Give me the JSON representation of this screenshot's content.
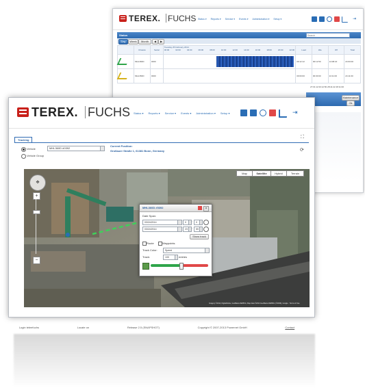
{
  "brand": {
    "name_bold": "TEREX.",
    "name_light": "FUCHS"
  },
  "colors": {
    "brand_red": "#c8201a",
    "link_blue": "#2a6db5",
    "panel_blue": "#2d6ab0",
    "track_green": "#2fa54a",
    "track_red": "#e04848"
  },
  "nav": {
    "items": [
      "Status ▾",
      "Reports ▾",
      "Service ▾",
      "Events ▾",
      "Administration ▾",
      "Setup ▾"
    ],
    "toolbar_icons": [
      "machine-icon",
      "document-icon",
      "globe-icon",
      "wrench-icon",
      "chart-icon",
      "logout-icon"
    ]
  },
  "back_window": {
    "panel_title": "Status",
    "search_placeholder": "Search",
    "view_buttons": [
      "Day",
      "Week",
      "Month"
    ],
    "timeline_label": "Tuesday 25 February 2014",
    "columns": [
      "Chassis",
      "Serial"
    ],
    "time_labels": [
      "00:00",
      "02:00",
      "04:00",
      "06:00",
      "08:00",
      "10:00",
      "12:00",
      "14:00",
      "16:00",
      "18:00",
      "20:00",
      "22:00"
    ],
    "right_columns": [
      "Load",
      "Idle",
      "Off",
      "Total"
    ],
    "rows": [
      {
        "chassis": "MHL360D",
        "serial": "0000",
        "values": [
          "09:12:12",
          "00:12:50",
          "14:08:22",
          "24:00:00"
        ]
      },
      {
        "chassis": "MHL350D",
        "serial": "0000",
        "values": [
          "00:00:00",
          "00:00:00",
          "24:11:00",
          "24:11:00"
        ]
      }
    ],
    "summary": "27:01:12  00:12:50  28:41:22  48:11:00",
    "maintenance_btn": "Maintenance",
    "ok_btn": "Ok"
  },
  "front_window": {
    "tab": "Tracking",
    "radio_vehicle": "Vehicle",
    "radio_group": "Vehicle Group",
    "vehicle_select": "MHL360D #0392",
    "position_label": "Current Position:",
    "position_address": "Großauer Straße 1, 61381 Bonn, Germany",
    "map_types": [
      "Map",
      "Satellite",
      "Hybrid",
      "Terrain"
    ],
    "attribution": "Imagery ©2014, DigitalGlobe, GeoBasis-DE/BKG, Map data ©2014 GeoBasis-DE/BKG (©2009), Google · Terms of Use",
    "popup": {
      "title": "MHL360D #0392",
      "date_span_label": "Date Span:",
      "from_date": "03/24/2014",
      "to_date": "03/24/2014",
      "from_hour": "0",
      "from_minute": "0",
      "to_hour": "23",
      "to_minute": "59",
      "show_track_btn": "Show track",
      "checkbox_route": "Route",
      "checkbox_waypoints": "Waypoints",
      "track_color_label": "Track Color:",
      "track_color_value": "Speed",
      "track_label": "Track:",
      "track_value": "100",
      "track_unit": "entries",
      "slider_level": 0.52
    }
  },
  "footer": {
    "items": [
      "Login teleefuchs",
      "Locate on",
      "Release 2.5 (SNAPSHOT)",
      "Copyright © 2007-2013 Powernet GmbH",
      "Contact"
    ]
  }
}
